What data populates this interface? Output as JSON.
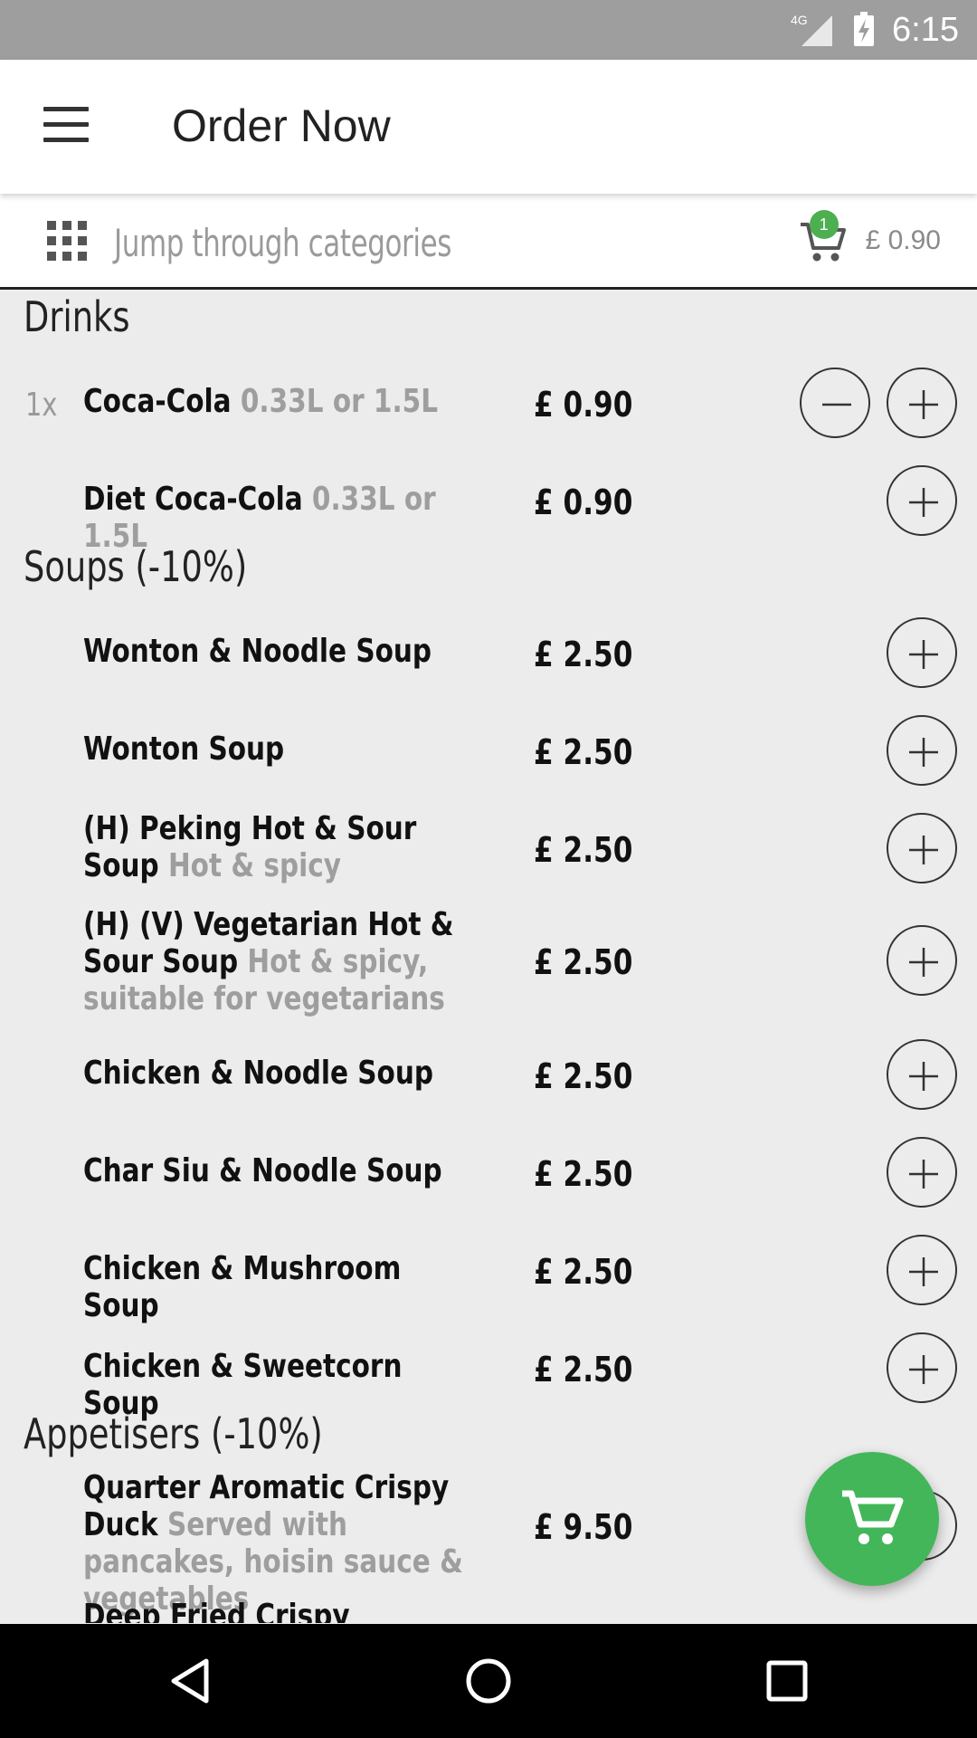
{
  "status_bar": {
    "network": "4G",
    "time": "6:15"
  },
  "app_bar": {
    "title": "Order Now"
  },
  "category_bar": {
    "placeholder": "Jump through categories",
    "cart_count": "1",
    "cart_total": "£ 0.90"
  },
  "sections": [
    {
      "title": "Drinks",
      "items": [
        {
          "qty": "1x",
          "name": "Coca-Cola",
          "desc": "0.33L or 1.5L",
          "price": "£ 0.90"
        },
        {
          "name": "Diet Coca-Cola",
          "desc": "0.33L or 1.5L",
          "price": "£ 0.90"
        }
      ]
    },
    {
      "title": "Soups (-10%)",
      "items": [
        {
          "name": "Wonton & Noodle Soup",
          "price": "£ 2.50"
        },
        {
          "name": "Wonton Soup",
          "price": "£ 2.50"
        },
        {
          "name": "(H) Peking Hot & Sour Soup",
          "desc": "Hot & spicy",
          "price": "£ 2.50"
        },
        {
          "name": "(H) (V) Vegetarian Hot & Sour Soup",
          "desc": "Hot & spicy, suitable for vegetarians",
          "price": "£ 2.50"
        },
        {
          "name": "Chicken & Noodle Soup",
          "price": "£ 2.50"
        },
        {
          "name": "Char Siu & Noodle Soup",
          "price": "£ 2.50"
        },
        {
          "name": "Chicken & Mushroom Soup",
          "price": "£ 2.50"
        },
        {
          "name": "Chicken & Sweetcorn Soup",
          "price": "£ 2.50"
        }
      ]
    },
    {
      "title": "Appetisers (-10%)",
      "items": [
        {
          "name": "Quarter Aromatic Crispy Duck",
          "desc": "Served with pancakes, hoisin sauce & vegetables",
          "price": "£ 9.50"
        },
        {
          "name": "Deep Fried Crispy Combination"
        }
      ]
    }
  ],
  "icons": {
    "menu": "hamburger-icon",
    "categories": "grid-icon",
    "cart": "cart-icon",
    "remove": "minus-icon",
    "add": "plus-icon",
    "fab": "cart-icon",
    "nav_back": "triangle-back-icon",
    "nav_home": "circle-home-icon",
    "nav_recents": "square-recents-icon"
  },
  "colors": {
    "accent": "#43b65a",
    "status_bar": "#9e9e9e",
    "background": "#ececec"
  }
}
